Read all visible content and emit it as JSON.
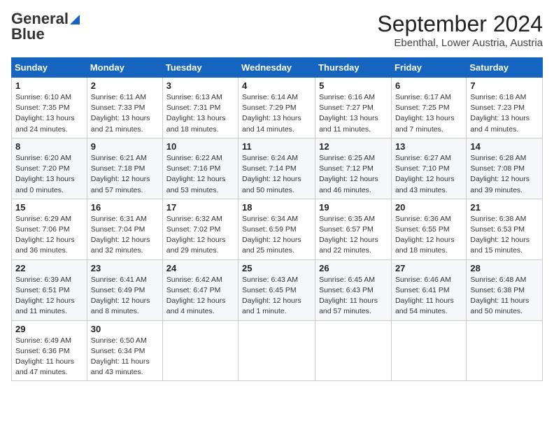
{
  "header": {
    "logo_general": "General",
    "logo_blue": "Blue",
    "title": "September 2024",
    "subtitle": "Ebenthal, Lower Austria, Austria"
  },
  "weekdays": [
    "Sunday",
    "Monday",
    "Tuesday",
    "Wednesday",
    "Thursday",
    "Friday",
    "Saturday"
  ],
  "weeks": [
    [
      {
        "day": "1",
        "info": "Sunrise: 6:10 AM\nSunset: 7:35 PM\nDaylight: 13 hours\nand 24 minutes."
      },
      {
        "day": "2",
        "info": "Sunrise: 6:11 AM\nSunset: 7:33 PM\nDaylight: 13 hours\nand 21 minutes."
      },
      {
        "day": "3",
        "info": "Sunrise: 6:13 AM\nSunset: 7:31 PM\nDaylight: 13 hours\nand 18 minutes."
      },
      {
        "day": "4",
        "info": "Sunrise: 6:14 AM\nSunset: 7:29 PM\nDaylight: 13 hours\nand 14 minutes."
      },
      {
        "day": "5",
        "info": "Sunrise: 6:16 AM\nSunset: 7:27 PM\nDaylight: 13 hours\nand 11 minutes."
      },
      {
        "day": "6",
        "info": "Sunrise: 6:17 AM\nSunset: 7:25 PM\nDaylight: 13 hours\nand 7 minutes."
      },
      {
        "day": "7",
        "info": "Sunrise: 6:18 AM\nSunset: 7:23 PM\nDaylight: 13 hours\nand 4 minutes."
      }
    ],
    [
      {
        "day": "8",
        "info": "Sunrise: 6:20 AM\nSunset: 7:20 PM\nDaylight: 13 hours\nand 0 minutes."
      },
      {
        "day": "9",
        "info": "Sunrise: 6:21 AM\nSunset: 7:18 PM\nDaylight: 12 hours\nand 57 minutes."
      },
      {
        "day": "10",
        "info": "Sunrise: 6:22 AM\nSunset: 7:16 PM\nDaylight: 12 hours\nand 53 minutes."
      },
      {
        "day": "11",
        "info": "Sunrise: 6:24 AM\nSunset: 7:14 PM\nDaylight: 12 hours\nand 50 minutes."
      },
      {
        "day": "12",
        "info": "Sunrise: 6:25 AM\nSunset: 7:12 PM\nDaylight: 12 hours\nand 46 minutes."
      },
      {
        "day": "13",
        "info": "Sunrise: 6:27 AM\nSunset: 7:10 PM\nDaylight: 12 hours\nand 43 minutes."
      },
      {
        "day": "14",
        "info": "Sunrise: 6:28 AM\nSunset: 7:08 PM\nDaylight: 12 hours\nand 39 minutes."
      }
    ],
    [
      {
        "day": "15",
        "info": "Sunrise: 6:29 AM\nSunset: 7:06 PM\nDaylight: 12 hours\nand 36 minutes."
      },
      {
        "day": "16",
        "info": "Sunrise: 6:31 AM\nSunset: 7:04 PM\nDaylight: 12 hours\nand 32 minutes."
      },
      {
        "day": "17",
        "info": "Sunrise: 6:32 AM\nSunset: 7:02 PM\nDaylight: 12 hours\nand 29 minutes."
      },
      {
        "day": "18",
        "info": "Sunrise: 6:34 AM\nSunset: 6:59 PM\nDaylight: 12 hours\nand 25 minutes."
      },
      {
        "day": "19",
        "info": "Sunrise: 6:35 AM\nSunset: 6:57 PM\nDaylight: 12 hours\nand 22 minutes."
      },
      {
        "day": "20",
        "info": "Sunrise: 6:36 AM\nSunset: 6:55 PM\nDaylight: 12 hours\nand 18 minutes."
      },
      {
        "day": "21",
        "info": "Sunrise: 6:38 AM\nSunset: 6:53 PM\nDaylight: 12 hours\nand 15 minutes."
      }
    ],
    [
      {
        "day": "22",
        "info": "Sunrise: 6:39 AM\nSunset: 6:51 PM\nDaylight: 12 hours\nand 11 minutes."
      },
      {
        "day": "23",
        "info": "Sunrise: 6:41 AM\nSunset: 6:49 PM\nDaylight: 12 hours\nand 8 minutes."
      },
      {
        "day": "24",
        "info": "Sunrise: 6:42 AM\nSunset: 6:47 PM\nDaylight: 12 hours\nand 4 minutes."
      },
      {
        "day": "25",
        "info": "Sunrise: 6:43 AM\nSunset: 6:45 PM\nDaylight: 12 hours\nand 1 minute."
      },
      {
        "day": "26",
        "info": "Sunrise: 6:45 AM\nSunset: 6:43 PM\nDaylight: 11 hours\nand 57 minutes."
      },
      {
        "day": "27",
        "info": "Sunrise: 6:46 AM\nSunset: 6:41 PM\nDaylight: 11 hours\nand 54 minutes."
      },
      {
        "day": "28",
        "info": "Sunrise: 6:48 AM\nSunset: 6:38 PM\nDaylight: 11 hours\nand 50 minutes."
      }
    ],
    [
      {
        "day": "29",
        "info": "Sunrise: 6:49 AM\nSunset: 6:36 PM\nDaylight: 11 hours\nand 47 minutes."
      },
      {
        "day": "30",
        "info": "Sunrise: 6:50 AM\nSunset: 6:34 PM\nDaylight: 11 hours\nand 43 minutes."
      },
      null,
      null,
      null,
      null,
      null
    ]
  ]
}
